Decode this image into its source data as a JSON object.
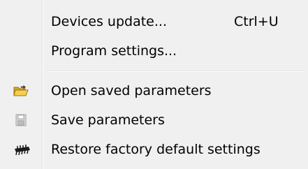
{
  "menu": {
    "items": [
      {
        "label": "Devices update...",
        "shortcut": "Ctrl+U",
        "icon": ""
      },
      {
        "label": "Program settings...",
        "shortcut": "",
        "icon": ""
      },
      {
        "label": "Open saved parameters",
        "shortcut": "",
        "icon": "folder-open-icon"
      },
      {
        "label": "Save parameters",
        "shortcut": "",
        "icon": "floppy-disk-icon"
      },
      {
        "label": "Restore factory default settings",
        "shortcut": "",
        "icon": "chip-icon"
      }
    ]
  },
  "colors": {
    "menu_background": "#f0f0f0",
    "text": "#000000",
    "folder_icon": "#e8b830",
    "disabled_icon": "#a9a9a9"
  }
}
